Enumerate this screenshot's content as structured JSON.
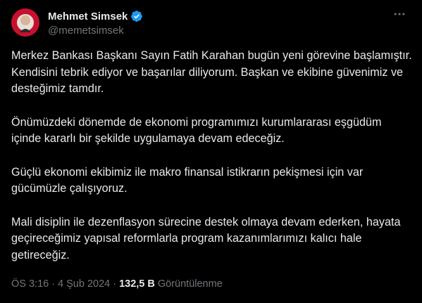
{
  "author": {
    "display_name": "Mehmet Simsek",
    "handle": "@memetsimsek",
    "verified_badge_color": "#1d9bf0"
  },
  "more_menu_icon": "ellipsis-icon",
  "body": {
    "paragraphs": [
      "Merkez Bankası Başkanı Sayın Fatih Karahan bugün yeni görevine başlamıştır. Kendisini tebrik ediyor ve başarılar diliyorum. Başkan ve ekibine güvenimiz ve desteğimiz tamdır.",
      "Önümüzdeki dönemde de ekonomi programımızı kurumlararası eşgüdüm içinde kararlı bir şekilde uygulamaya devam edeceğiz.",
      "Güçlü ekonomi ekibimiz ile makro finansal istikrarın pekişmesi için var gücümüzle çalışıyoruz.",
      "Mali disiplin ile dezenflasyon sürecine destek olmaya devam ederken, hayata geçireceğimiz yapısal reformlarla program kazanımlarımızı kalıcı hale getireceğiz."
    ]
  },
  "meta": {
    "time": "ÖS 3:16",
    "separator": "·",
    "date": "4 Şub 2024",
    "views_count": "132,5 B",
    "views_label": "Görüntülenme"
  },
  "colors": {
    "background": "#000000",
    "text": "#e7e9ea",
    "secondary": "#71767b"
  }
}
